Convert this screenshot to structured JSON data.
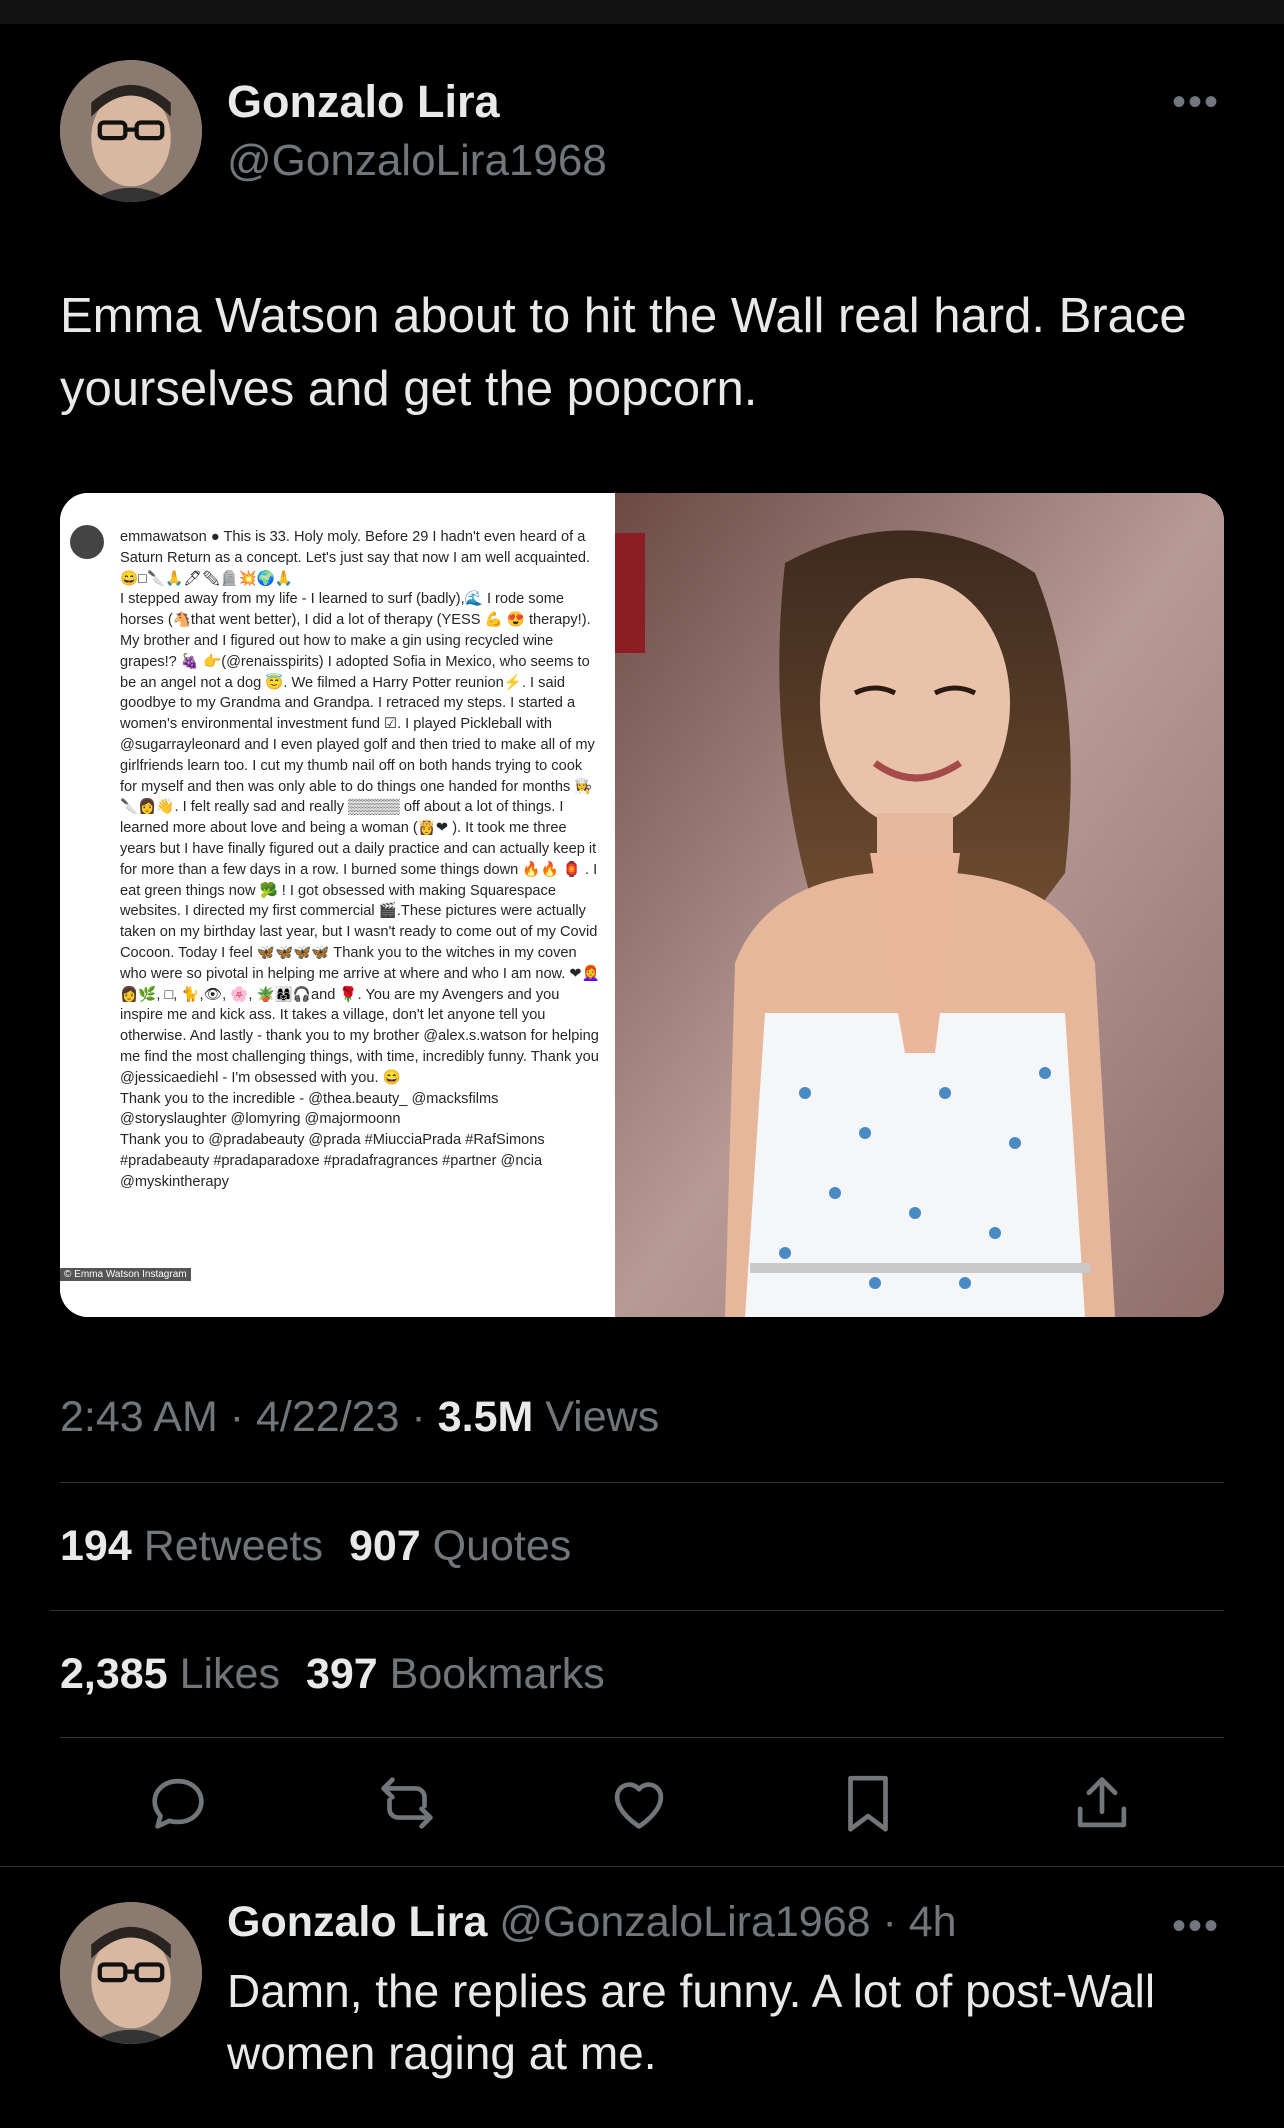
{
  "tweet": {
    "author_name": "Gonzalo Lira",
    "author_handle": "@GonzaloLira1968",
    "text": "Emma Watson about to hit the Wall real hard. Brace yourselves and get the popcorn.",
    "more_icon": "more-horizontal-icon",
    "media": {
      "caption": "emmawatson ● This is 33. Holy moly. Before 29 I hadn't even heard of a Saturn Return as a concept. Let's just say that now I am well acquainted. 😄□🔪🙏🖊✏🪦💥🌍🙏\nI stepped away from my life - I learned to surf (badly),🌊 I rode some horses (🐴that went better), I did a lot of therapy (YESS 💪 😍 therapy!). My brother and I figured out how to make a gin using recycled wine grapes!? 🍇 👉(@renaisspirits) I adopted Sofia in Mexico, who seems to be an angel not a dog 😇. We filmed a Harry Potter reunion⚡. I said goodbye to my Grandma and Grandpa. I retraced my steps. I started a women's environmental investment fund ☑. I played Pickleball with @sugarrayleonard and I even played golf and then tried to make all of my girlfriends learn too. I cut my thumb nail off on both hands trying to cook for myself and then was only able to do things one handed for months 👩‍🍳🔪👩👋. I felt really sad and really ▒▒▒▒▒ off about a lot of things. I learned more about love and being a woman (👸❤ ). It took me three years but I have finally figured out a daily practice and can actually keep it for more than a few days in a row. I burned some things down 🔥🔥 🏮 . I eat green things now 🥦 ! I got obsessed with making Squarespace websites. I directed my first commercial 🎬.These pictures were actually taken on my birthday last year, but I wasn't ready to come out of my Covid Cocoon. Today I feel 🦋🦋🦋🦋 Thank you to the witches in my coven who were so pivotal in helping me arrive at where and who I am now. ❤👩‍🦰👩🌿, □, 🐈,👁, 🌸, 🪴👩‍👩‍👧🎧and 🌹. You are my Avengers and you inspire me and kick ass. It takes a village, don't let anyone tell you otherwise. And lastly - thank you to my brother @alex.s.watson for helping me find the most challenging things, with time, incredibly funny. Thank you @jessicaediehl - I'm obsessed with you. 😄\nThank you to the incredible - @thea.beauty_ @macksfilms @storyslaughter @lomyring @majormoonn\nThank you to @pradabeauty @prada #MiucciaPrada #RafSimons #pradabeauty #pradaparadoxe #pradafragrances #partner @ncia @myskintherapy",
      "credit": "© Emma Watson Instagram"
    },
    "time": "2:43 AM",
    "date": "4/22/23",
    "views_count": "3.5M",
    "views_label": "Views",
    "retweets_count": "194",
    "retweets_label": "Retweets",
    "quotes_count": "907",
    "quotes_label": "Quotes",
    "likes_count": "2,385",
    "likes_label": "Likes",
    "bookmarks_count": "397",
    "bookmarks_label": "Bookmarks"
  },
  "actions": [
    {
      "icon": "reply-icon"
    },
    {
      "icon": "retweet-icon"
    },
    {
      "icon": "like-icon"
    },
    {
      "icon": "bookmark-icon"
    },
    {
      "icon": "share-icon"
    }
  ],
  "reply": {
    "author_name": "Gonzalo Lira",
    "author_handle": "@GonzaloLira1968",
    "time_ago": "4h",
    "text": "Damn, the replies are funny. A lot of post-Wall women raging at me."
  },
  "colors": {
    "background": "#000000",
    "text_primary": "#e7e9ea",
    "text_secondary": "#71767b",
    "divider": "#2f3336"
  }
}
